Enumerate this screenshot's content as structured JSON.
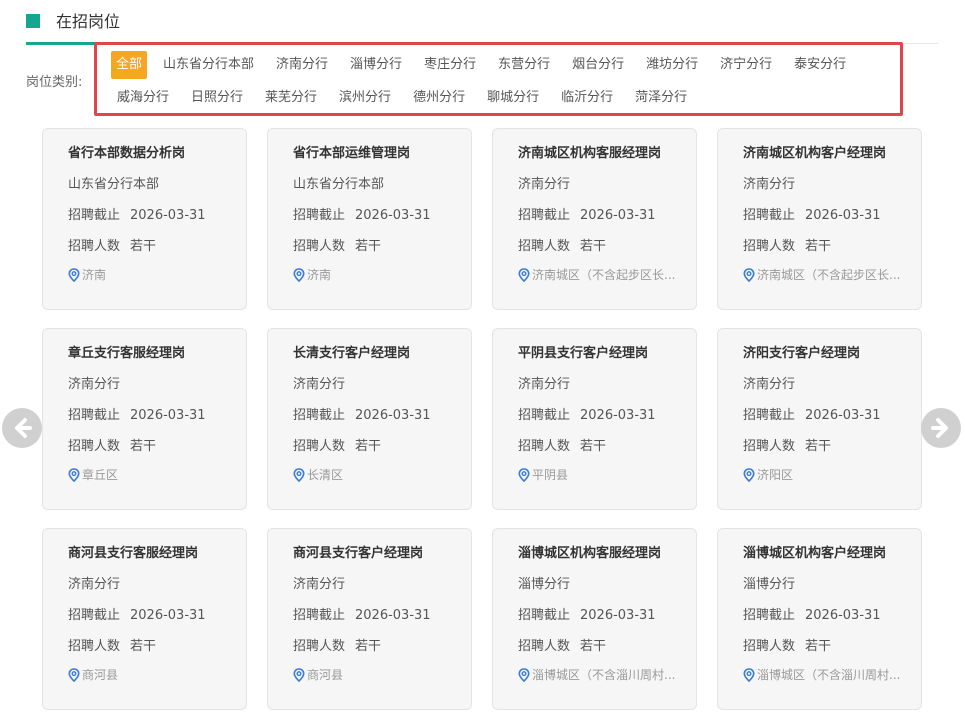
{
  "section": {
    "title": "在招岗位"
  },
  "filter": {
    "label": "岗位类别:",
    "row1": [
      "全部",
      "山东省分行本部",
      "济南分行",
      "淄博分行",
      "枣庄分行",
      "东营分行",
      "烟台分行",
      "潍坊分行",
      "济宁分行",
      "泰安分行"
    ],
    "row2": [
      "威海分行",
      "日照分行",
      "莱芜分行",
      "滨州分行",
      "德州分行",
      "聊城分行",
      "临沂分行",
      "菏泽分行"
    ],
    "active": "全部"
  },
  "labels": {
    "deadline": "招聘截止",
    "headcount": "招聘人数"
  },
  "cards": [
    {
      "title": "省行本部数据分析岗",
      "org": "山东省分行本部",
      "deadline": "2026-03-31",
      "headcount": "若干",
      "location": "济南"
    },
    {
      "title": "省行本部运维管理岗",
      "org": "山东省分行本部",
      "deadline": "2026-03-31",
      "headcount": "若干",
      "location": "济南"
    },
    {
      "title": "济南城区机构客服经理岗",
      "org": "济南分行",
      "deadline": "2026-03-31",
      "headcount": "若干",
      "location": "济南城区（不含起步区长..."
    },
    {
      "title": "济南城区机构客户经理岗",
      "org": "济南分行",
      "deadline": "2026-03-31",
      "headcount": "若干",
      "location": "济南城区（不含起步区长..."
    },
    {
      "title": "章丘支行客服经理岗",
      "org": "济南分行",
      "deadline": "2026-03-31",
      "headcount": "若干",
      "location": "章丘区"
    },
    {
      "title": "长清支行客户经理岗",
      "org": "济南分行",
      "deadline": "2026-03-31",
      "headcount": "若干",
      "location": "长清区"
    },
    {
      "title": "平阴县支行客户经理岗",
      "org": "济南分行",
      "deadline": "2026-03-31",
      "headcount": "若干",
      "location": "平阴县"
    },
    {
      "title": "济阳支行客户经理岗",
      "org": "济南分行",
      "deadline": "2026-03-31",
      "headcount": "若干",
      "location": "济阳区"
    },
    {
      "title": "商河县支行客服经理岗",
      "org": "济南分行",
      "deadline": "2026-03-31",
      "headcount": "若干",
      "location": "商河县"
    },
    {
      "title": "商河县支行客户经理岗",
      "org": "济南分行",
      "deadline": "2026-03-31",
      "headcount": "若干",
      "location": "商河县"
    },
    {
      "title": "淄博城区机构客服经理岗",
      "org": "淄博分行",
      "deadline": "2026-03-31",
      "headcount": "若干",
      "location": "淄博城区（不含淄川周村..."
    },
    {
      "title": "淄博城区机构客户经理岗",
      "org": "淄博分行",
      "deadline": "2026-03-31",
      "headcount": "若干",
      "location": "淄博城区（不含淄川周村..."
    }
  ],
  "nav": {
    "prev_icon": "arrow-left-circle-icon",
    "next_icon": "arrow-right-circle-icon"
  },
  "colors": {
    "accent": "#14a68f",
    "active_tag": "#f5a623",
    "highlight_border": "#e0454b",
    "pin": "#3b7bd8"
  }
}
